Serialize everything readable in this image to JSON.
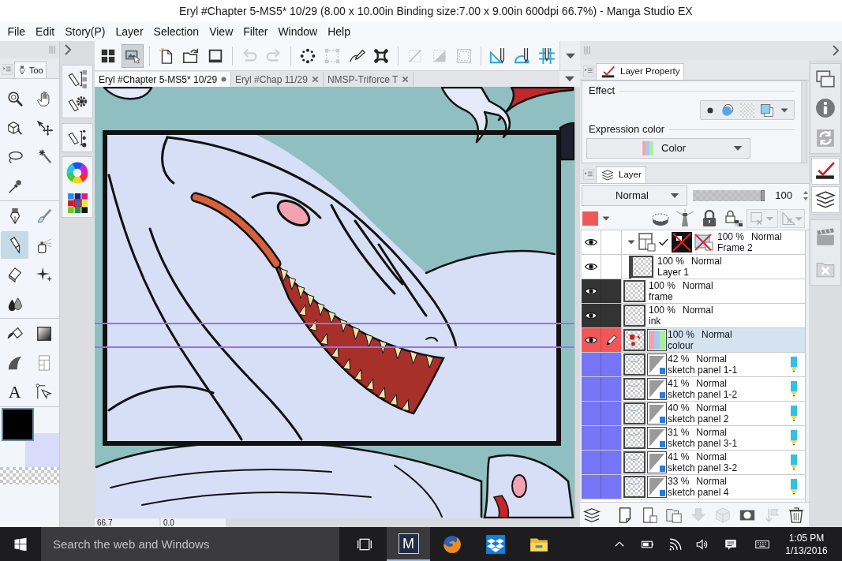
{
  "window": {
    "title": "Eryl #Chapter 5-MS5* 10/29 (8.00 x 10.00in Binding size:7.00 x 9.00in 600dpi 66.7%) - Manga Studio EX"
  },
  "menu": [
    "File",
    "Edit",
    "Story(P)",
    "Layer",
    "Selection",
    "View",
    "Filter",
    "Window",
    "Help"
  ],
  "toolbar": [
    {
      "selected": false,
      "disabled": false
    },
    {
      "selected": true,
      "disabled": false
    },
    {
      "selected": false,
      "disabled": false
    },
    {
      "selected": false,
      "disabled": false
    },
    {
      "selected": false,
      "disabled": false
    },
    {
      "selected": false,
      "disabled": true
    },
    {
      "selected": false,
      "disabled": true
    },
    {
      "selected": false,
      "disabled": false
    },
    {
      "selected": false,
      "disabled": true
    },
    {
      "selected": false,
      "disabled": false
    },
    {
      "selected": false,
      "disabled": false
    },
    {
      "selected": false,
      "disabled": true
    },
    {
      "selected": false,
      "disabled": true
    },
    {
      "selected": false,
      "disabled": true
    },
    {
      "selected": false,
      "disabled": false
    },
    {
      "selected": false,
      "disabled": false
    },
    {
      "selected": false,
      "disabled": false
    }
  ],
  "tool_palette": {
    "tab": "Too",
    "tool_groups": [
      [
        {
          "selected": false
        },
        {
          "selected": false
        },
        {
          "selected": false
        },
        {
          "selected": false
        },
        {
          "selected": false
        },
        {
          "selected": false
        },
        {
          "selected": false
        }
      ],
      [
        {
          "selected": false
        },
        {
          "selected": false
        },
        {
          "selected": true
        },
        {
          "selected": false
        },
        {
          "selected": false
        },
        {
          "selected": false
        },
        {
          "selected": false
        }
      ],
      [
        {
          "selected": false
        },
        {
          "selected": false
        },
        {
          "selected": false
        },
        {
          "selected": false
        },
        {
          "selected": false,
          "label": "A"
        },
        {
          "selected": false
        }
      ]
    ],
    "color_swatches": [
      {
        "color": "#000000"
      },
      {
        "color": "#d9dbfa"
      }
    ]
  },
  "document_tabs": [
    {
      "label": "Eryl #Chapter 5-MS5* 10/29",
      "selected": true,
      "modified": true
    },
    {
      "label": "Eryl #Chap 11/29",
      "selected": false,
      "modified": false
    },
    {
      "label": "NMSP-Triforce T",
      "selected": false,
      "modified": false
    }
  ],
  "status_fields": [
    "66.7",
    "0.0"
  ],
  "layer_property": {
    "tab": "Layer Property",
    "effect": {
      "label": "Effect"
    },
    "expression_color": {
      "label": "Expression color",
      "value": "Color"
    }
  },
  "layer_panel": {
    "tab": "Layer",
    "blend_mode": "Normal",
    "opacity": {
      "level": 1,
      "reading": "100"
    },
    "layer_color": {
      "color": "#f25757"
    },
    "tools": [
      {
        "disabled": false
      },
      {
        "disabled": false
      },
      {
        "disabled": false
      },
      {
        "disabled": false
      },
      {
        "disabled": true
      },
      {
        "disabled": true
      }
    ],
    "layers": [
      {
        "kind": "folder",
        "opacity": "100 %",
        "blend_mode": "Normal",
        "name": "Frame 2",
        "visible": true,
        "selected": false,
        "draft": false,
        "expanded": true,
        "children": [
          {
            "kind": "raster",
            "opacity": "100 %",
            "blend_mode": "Normal",
            "name": "Layer 1",
            "visible": true,
            "selected": false,
            "draft": false
          }
        ]
      },
      {
        "kind": "raster",
        "opacity": "100 %",
        "blend_mode": "Normal",
        "name": "frame",
        "visible": true,
        "selected": false,
        "draft": false,
        "color": "#333333"
      },
      {
        "kind": "raster",
        "opacity": "100 %",
        "blend_mode": "Normal",
        "name": "ink",
        "visible": true,
        "selected": false,
        "draft": false,
        "color": "#333333"
      },
      {
        "kind": "color",
        "opacity": "100 %",
        "blend_mode": "Normal",
        "name": "colour",
        "visible": true,
        "selected": true,
        "draft": false,
        "color": "#f25757"
      },
      {
        "kind": "gray",
        "opacity": "42 %",
        "blend_mode": "Normal",
        "name": "sketch panel 1-1",
        "visible": false,
        "selected": false,
        "draft": true,
        "color": "#7575f5"
      },
      {
        "kind": "gray",
        "opacity": "41 %",
        "blend_mode": "Normal",
        "name": "sketch panel 1-2",
        "visible": false,
        "selected": false,
        "draft": true,
        "color": "#7575f5"
      },
      {
        "kind": "gray",
        "opacity": "40 %",
        "blend_mode": "Normal",
        "name": "sketch panel 2",
        "visible": false,
        "selected": false,
        "draft": true,
        "color": "#7575f5"
      },
      {
        "kind": "gray",
        "opacity": "31 %",
        "blend_mode": "Normal",
        "name": "sketch panel 3-1",
        "visible": false,
        "selected": false,
        "draft": true,
        "color": "#7575f5"
      },
      {
        "kind": "gray",
        "opacity": "41 %",
        "blend_mode": "Normal",
        "name": "sketch panel 3-2",
        "visible": false,
        "selected": false,
        "draft": true,
        "color": "#7575f5"
      },
      {
        "kind": "gray",
        "opacity": "33 %",
        "blend_mode": "Normal",
        "name": "sketch panel 4",
        "visible": false,
        "selected": false,
        "draft": true,
        "color": "#7575f5"
      }
    ],
    "buttons": [
      {
        "disabled": false
      },
      {
        "disabled": false
      },
      {
        "disabled": false
      },
      {
        "disabled": false
      },
      {
        "disabled": true
      },
      {
        "disabled": true
      },
      {
        "disabled": false
      },
      {
        "disabled": true
      },
      {
        "disabled": false
      }
    ]
  },
  "dock": [
    [
      {
        "selected": false
      },
      {
        "selected": false
      },
      {
        "selected": false
      }
    ],
    [
      {
        "selected": true
      },
      {
        "selected": true
      }
    ],
    [
      {
        "selected": false
      },
      {
        "selected": false
      }
    ]
  ],
  "taskbar": {
    "search": {
      "placeholder": "Search the web and Windows"
    },
    "apps": [
      {
        "active": true,
        "label": "M"
      },
      {
        "active": false
      },
      {
        "active": false
      },
      {
        "active": false
      }
    ],
    "time": "1:05 PM",
    "date": "1/13/2016"
  }
}
